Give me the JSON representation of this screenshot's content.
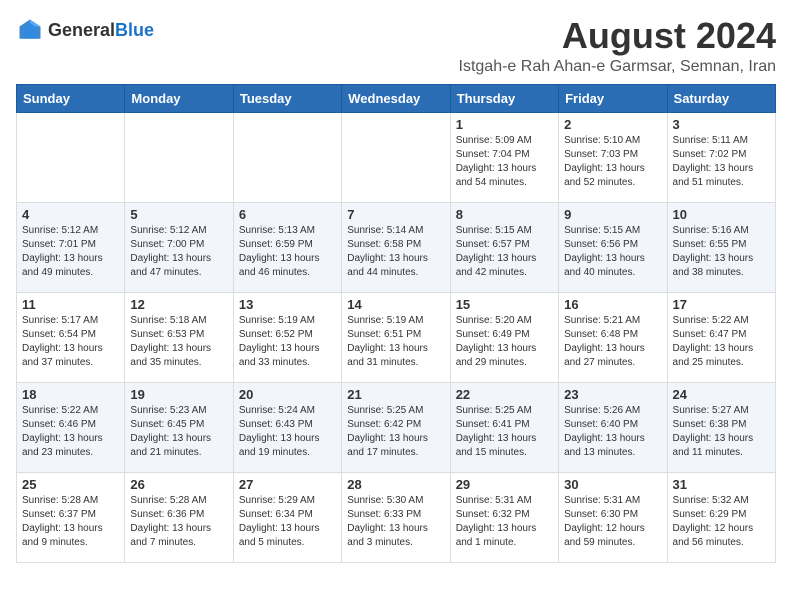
{
  "logo": {
    "text_general": "General",
    "text_blue": "Blue"
  },
  "title": "August 2024",
  "subtitle": "Istgah-e Rah Ahan-e Garmsar, Semnan, Iran",
  "headers": [
    "Sunday",
    "Monday",
    "Tuesday",
    "Wednesday",
    "Thursday",
    "Friday",
    "Saturday"
  ],
  "weeks": [
    [
      {
        "day": "",
        "info": ""
      },
      {
        "day": "",
        "info": ""
      },
      {
        "day": "",
        "info": ""
      },
      {
        "day": "",
        "info": ""
      },
      {
        "day": "1",
        "info": "Sunrise: 5:09 AM\nSunset: 7:04 PM\nDaylight: 13 hours\nand 54 minutes."
      },
      {
        "day": "2",
        "info": "Sunrise: 5:10 AM\nSunset: 7:03 PM\nDaylight: 13 hours\nand 52 minutes."
      },
      {
        "day": "3",
        "info": "Sunrise: 5:11 AM\nSunset: 7:02 PM\nDaylight: 13 hours\nand 51 minutes."
      }
    ],
    [
      {
        "day": "4",
        "info": "Sunrise: 5:12 AM\nSunset: 7:01 PM\nDaylight: 13 hours\nand 49 minutes."
      },
      {
        "day": "5",
        "info": "Sunrise: 5:12 AM\nSunset: 7:00 PM\nDaylight: 13 hours\nand 47 minutes."
      },
      {
        "day": "6",
        "info": "Sunrise: 5:13 AM\nSunset: 6:59 PM\nDaylight: 13 hours\nand 46 minutes."
      },
      {
        "day": "7",
        "info": "Sunrise: 5:14 AM\nSunset: 6:58 PM\nDaylight: 13 hours\nand 44 minutes."
      },
      {
        "day": "8",
        "info": "Sunrise: 5:15 AM\nSunset: 6:57 PM\nDaylight: 13 hours\nand 42 minutes."
      },
      {
        "day": "9",
        "info": "Sunrise: 5:15 AM\nSunset: 6:56 PM\nDaylight: 13 hours\nand 40 minutes."
      },
      {
        "day": "10",
        "info": "Sunrise: 5:16 AM\nSunset: 6:55 PM\nDaylight: 13 hours\nand 38 minutes."
      }
    ],
    [
      {
        "day": "11",
        "info": "Sunrise: 5:17 AM\nSunset: 6:54 PM\nDaylight: 13 hours\nand 37 minutes."
      },
      {
        "day": "12",
        "info": "Sunrise: 5:18 AM\nSunset: 6:53 PM\nDaylight: 13 hours\nand 35 minutes."
      },
      {
        "day": "13",
        "info": "Sunrise: 5:19 AM\nSunset: 6:52 PM\nDaylight: 13 hours\nand 33 minutes."
      },
      {
        "day": "14",
        "info": "Sunrise: 5:19 AM\nSunset: 6:51 PM\nDaylight: 13 hours\nand 31 minutes."
      },
      {
        "day": "15",
        "info": "Sunrise: 5:20 AM\nSunset: 6:49 PM\nDaylight: 13 hours\nand 29 minutes."
      },
      {
        "day": "16",
        "info": "Sunrise: 5:21 AM\nSunset: 6:48 PM\nDaylight: 13 hours\nand 27 minutes."
      },
      {
        "day": "17",
        "info": "Sunrise: 5:22 AM\nSunset: 6:47 PM\nDaylight: 13 hours\nand 25 minutes."
      }
    ],
    [
      {
        "day": "18",
        "info": "Sunrise: 5:22 AM\nSunset: 6:46 PM\nDaylight: 13 hours\nand 23 minutes."
      },
      {
        "day": "19",
        "info": "Sunrise: 5:23 AM\nSunset: 6:45 PM\nDaylight: 13 hours\nand 21 minutes."
      },
      {
        "day": "20",
        "info": "Sunrise: 5:24 AM\nSunset: 6:43 PM\nDaylight: 13 hours\nand 19 minutes."
      },
      {
        "day": "21",
        "info": "Sunrise: 5:25 AM\nSunset: 6:42 PM\nDaylight: 13 hours\nand 17 minutes."
      },
      {
        "day": "22",
        "info": "Sunrise: 5:25 AM\nSunset: 6:41 PM\nDaylight: 13 hours\nand 15 minutes."
      },
      {
        "day": "23",
        "info": "Sunrise: 5:26 AM\nSunset: 6:40 PM\nDaylight: 13 hours\nand 13 minutes."
      },
      {
        "day": "24",
        "info": "Sunrise: 5:27 AM\nSunset: 6:38 PM\nDaylight: 13 hours\nand 11 minutes."
      }
    ],
    [
      {
        "day": "25",
        "info": "Sunrise: 5:28 AM\nSunset: 6:37 PM\nDaylight: 13 hours\nand 9 minutes."
      },
      {
        "day": "26",
        "info": "Sunrise: 5:28 AM\nSunset: 6:36 PM\nDaylight: 13 hours\nand 7 minutes."
      },
      {
        "day": "27",
        "info": "Sunrise: 5:29 AM\nSunset: 6:34 PM\nDaylight: 13 hours\nand 5 minutes."
      },
      {
        "day": "28",
        "info": "Sunrise: 5:30 AM\nSunset: 6:33 PM\nDaylight: 13 hours\nand 3 minutes."
      },
      {
        "day": "29",
        "info": "Sunrise: 5:31 AM\nSunset: 6:32 PM\nDaylight: 13 hours\nand 1 minute."
      },
      {
        "day": "30",
        "info": "Sunrise: 5:31 AM\nSunset: 6:30 PM\nDaylight: 12 hours\nand 59 minutes."
      },
      {
        "day": "31",
        "info": "Sunrise: 5:32 AM\nSunset: 6:29 PM\nDaylight: 12 hours\nand 56 minutes."
      }
    ]
  ]
}
